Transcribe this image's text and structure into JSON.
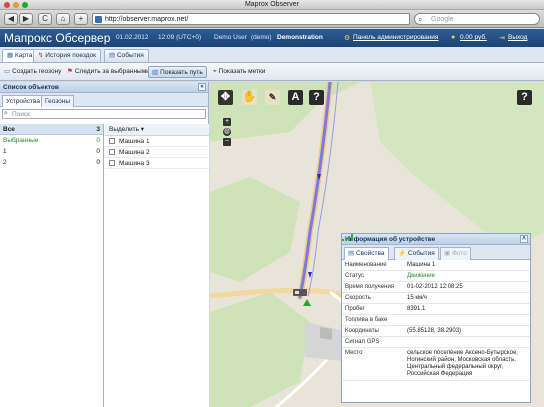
{
  "window": {
    "title": "Maprox Observer"
  },
  "browser": {
    "url": "http://observer.maprox.net/",
    "search_placeholder": "Google",
    "back": "◀",
    "forward": "▶",
    "reload": "C",
    "home": "⌂",
    "add": "+"
  },
  "header": {
    "logo": "Мапрокс Обсервер",
    "date": "01.02.2012",
    "time": "12:09 (UTC+0)",
    "user": "Demo User",
    "role": "(demo)",
    "company": "Demonstration",
    "admin_link": "Панель администрирования",
    "balance": "0.00 руб.",
    "logout": "Выход"
  },
  "tabs": [
    {
      "label": "Карта"
    },
    {
      "label": "История поездок"
    },
    {
      "label": "События"
    }
  ],
  "actions": [
    {
      "label": "Создать геозону"
    },
    {
      "label": "Следить за выбранными"
    },
    {
      "label": "Показать путь"
    },
    {
      "label": "Показать метки"
    }
  ],
  "left_panel": {
    "title": "Список объектов",
    "tabs": [
      "Устройства",
      "Геозоны"
    ],
    "search_placeholder": "Поиск",
    "groups": [
      {
        "name": "Все",
        "count": "3"
      },
      {
        "name": "Выбранные",
        "count": "0"
      },
      {
        "name": "1",
        "count": "0"
      },
      {
        "name": "2",
        "count": "0"
      }
    ],
    "select_label": "Выделить ▾",
    "objects": [
      "Машина 1",
      "Машина 2",
      "Машина 3"
    ]
  },
  "map_tools": [
    "✥",
    "✋",
    "A",
    "?"
  ],
  "map_help": "?",
  "info_panel": {
    "title": "Информация об устройстве",
    "tabs": [
      "Свойства",
      "События",
      "Фото"
    ],
    "rows": [
      {
        "k": "Наименование",
        "v": "Машина 1"
      },
      {
        "k": "Статус",
        "v": "Движение"
      },
      {
        "k": "Время получения",
        "v": "01-02-2012 12:08:25"
      },
      {
        "k": "Скорость",
        "v": "15 км/ч"
      },
      {
        "k": "Пробег",
        "v": "8391.1"
      },
      {
        "k": "Топлива в баке",
        "v": ""
      },
      {
        "k": "Координаты",
        "v": "(55.85128, 38.2903)"
      },
      {
        "k": "Сигнал GPS",
        "v": ""
      },
      {
        "k": "Место",
        "v": "сельское поселение Аксено-Бутырское, Ногинский район, Московская область, Центральный федеральный округ, Российская Федерация"
      }
    ]
  },
  "colors": {
    "header": "#1c4475",
    "accent": "#3a6fb0",
    "route": "#7a7ae0",
    "status_green": "#2a8a2a"
  }
}
